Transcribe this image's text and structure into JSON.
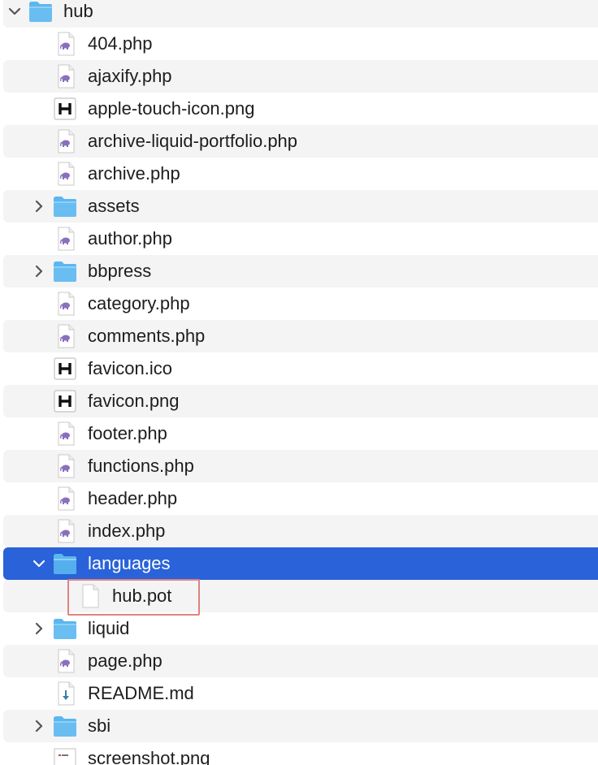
{
  "colors": {
    "selection": "#2a62d9",
    "stripe": "#f4f4f5",
    "folder": "#5ab7f0",
    "highlight_outline": "#e0837f",
    "php_icon": "#8a6fbd"
  },
  "items": [
    {
      "name": "hub",
      "kind": "folder",
      "depth": 0,
      "state": "expanded",
      "icon": "folder-icon"
    },
    {
      "name": "404.php",
      "kind": "php",
      "depth": 1,
      "icon": "php-file-icon"
    },
    {
      "name": "ajaxify.php",
      "kind": "php",
      "depth": 1,
      "icon": "php-file-icon"
    },
    {
      "name": "apple-touch-icon.png",
      "kind": "h",
      "depth": 1,
      "icon": "h-image-icon"
    },
    {
      "name": "archive-liquid-portfolio.php",
      "kind": "php",
      "depth": 1,
      "icon": "php-file-icon"
    },
    {
      "name": "archive.php",
      "kind": "php",
      "depth": 1,
      "icon": "php-file-icon"
    },
    {
      "name": "assets",
      "kind": "folder",
      "depth": 1,
      "state": "collapsed",
      "icon": "folder-icon"
    },
    {
      "name": "author.php",
      "kind": "php",
      "depth": 1,
      "icon": "php-file-icon"
    },
    {
      "name": "bbpress",
      "kind": "folder",
      "depth": 1,
      "state": "collapsed",
      "icon": "folder-icon"
    },
    {
      "name": "category.php",
      "kind": "php",
      "depth": 1,
      "icon": "php-file-icon"
    },
    {
      "name": "comments.php",
      "kind": "php",
      "depth": 1,
      "icon": "php-file-icon"
    },
    {
      "name": "favicon.ico",
      "kind": "h",
      "depth": 1,
      "icon": "h-image-icon"
    },
    {
      "name": "favicon.png",
      "kind": "h",
      "depth": 1,
      "icon": "h-image-icon"
    },
    {
      "name": "footer.php",
      "kind": "php",
      "depth": 1,
      "icon": "php-file-icon"
    },
    {
      "name": "functions.php",
      "kind": "php",
      "depth": 1,
      "icon": "php-file-icon"
    },
    {
      "name": "header.php",
      "kind": "php",
      "depth": 1,
      "icon": "php-file-icon"
    },
    {
      "name": "index.php",
      "kind": "php",
      "depth": 1,
      "icon": "php-file-icon"
    },
    {
      "name": "languages",
      "kind": "folder",
      "depth": 1,
      "state": "expanded",
      "selected": true,
      "icon": "folder-icon"
    },
    {
      "name": "hub.pot",
      "kind": "blank",
      "depth": 2,
      "highlighted": true,
      "icon": "document-icon"
    },
    {
      "name": "liquid",
      "kind": "folder",
      "depth": 1,
      "state": "collapsed",
      "icon": "folder-icon"
    },
    {
      "name": "page.php",
      "kind": "php",
      "depth": 1,
      "icon": "php-file-icon"
    },
    {
      "name": "README.md",
      "kind": "md",
      "depth": 1,
      "icon": "markdown-file-icon"
    },
    {
      "name": "sbi",
      "kind": "folder",
      "depth": 1,
      "state": "collapsed",
      "icon": "folder-icon"
    },
    {
      "name": "screenshot.png",
      "kind": "png",
      "depth": 1,
      "icon": "image-file-icon"
    }
  ]
}
